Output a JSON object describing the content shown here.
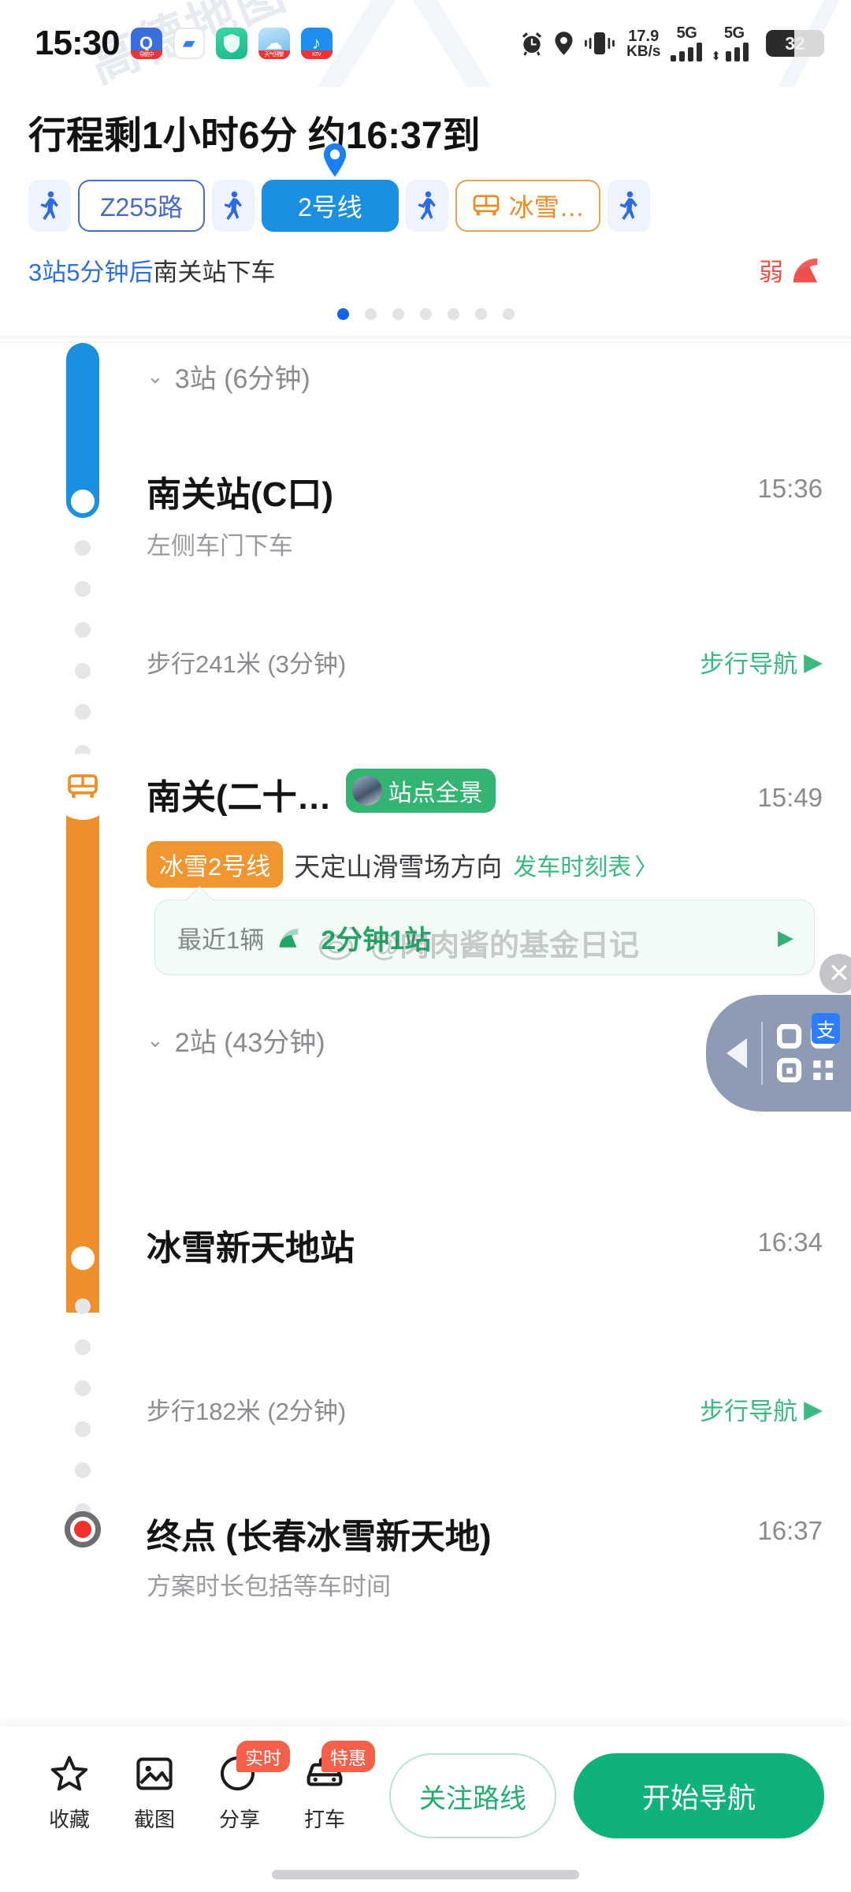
{
  "status_bar": {
    "time": "15:30",
    "app_icons": [
      "amap-icon",
      "chat-icon",
      "shield-icon",
      "weather-icon",
      "music-icon"
    ],
    "icons": [
      "alarm-icon",
      "location-icon",
      "vibrate-icon"
    ],
    "net_speed_value": "17.9",
    "net_speed_unit": "KB/s",
    "network_type_1": "5G",
    "network_type_2": "5G",
    "battery_percent": "32"
  },
  "header": {
    "eta_title": "行程剩1小时6分 约16:37到",
    "chips": [
      {
        "type": "walk",
        "label": "",
        "name": "walk-segment-1"
      },
      {
        "type": "bus-outline",
        "label": "Z255路",
        "name": "route-chip-z255"
      },
      {
        "type": "walk",
        "label": "",
        "name": "walk-segment-2"
      },
      {
        "type": "metro-active",
        "label": "2号线",
        "name": "route-chip-line2"
      },
      {
        "type": "walk",
        "label": "",
        "name": "walk-segment-3"
      },
      {
        "type": "bus-orange",
        "label": "冰雪…",
        "name": "route-chip-bingxue"
      },
      {
        "type": "walk",
        "label": "",
        "name": "walk-segment-4"
      }
    ],
    "status_prefix": "3站5分钟后",
    "status_suffix": "南关站下车",
    "signal_label": "弱",
    "pager_total": 7,
    "pager_active": 1
  },
  "timeline": {
    "seg1_collapse": "3站 (6分钟)",
    "station1_name": "南关站(C口)",
    "station1_time": "15:36",
    "station1_sub": "左侧车门下车",
    "walk1_text": "步行241米 (3分钟)",
    "walk1_action": "步行导航",
    "station2_name": "南关(二十…",
    "station2_time": "15:49",
    "pano_label": "站点全景",
    "line_tag": "冰雪2号线",
    "direction": "天定山滑雪场方向",
    "schedule_link": "发车时刻表",
    "arrival_label": "最近1辆",
    "arrival_main": "2分钟1站",
    "seg2_collapse": "2站 (43分钟)",
    "station3_name": "冰雪新天地站",
    "station3_time": "16:34",
    "walk2_text": "步行182米 (2分钟)",
    "walk2_action": "步行导航",
    "end_name": "终点 (长春冰雪新天地)",
    "end_time": "16:37",
    "footnote": "方案时长包括等车时间"
  },
  "watermark": {
    "handle": "@肉肉酱的基金日记",
    "corner_text": "高德地图"
  },
  "float_widget": {
    "badge": "支"
  },
  "bottom_bar": {
    "actions": [
      {
        "label": "收藏",
        "icon": "star-icon",
        "badge": ""
      },
      {
        "label": "截图",
        "icon": "image-icon",
        "badge": ""
      },
      {
        "label": "分享",
        "icon": "share-icon",
        "badge": "实时"
      },
      {
        "label": "打车",
        "icon": "taxi-icon",
        "badge": "特惠"
      }
    ],
    "follow_label": "关注路线",
    "start_label": "开始导航"
  },
  "colors": {
    "metro_blue": "#1b8fe0",
    "bus_orange": "#ef8f2b",
    "accent_green": "#0fb37a",
    "link_blue": "#2d6fdb",
    "warn_red": "#f0504a"
  }
}
